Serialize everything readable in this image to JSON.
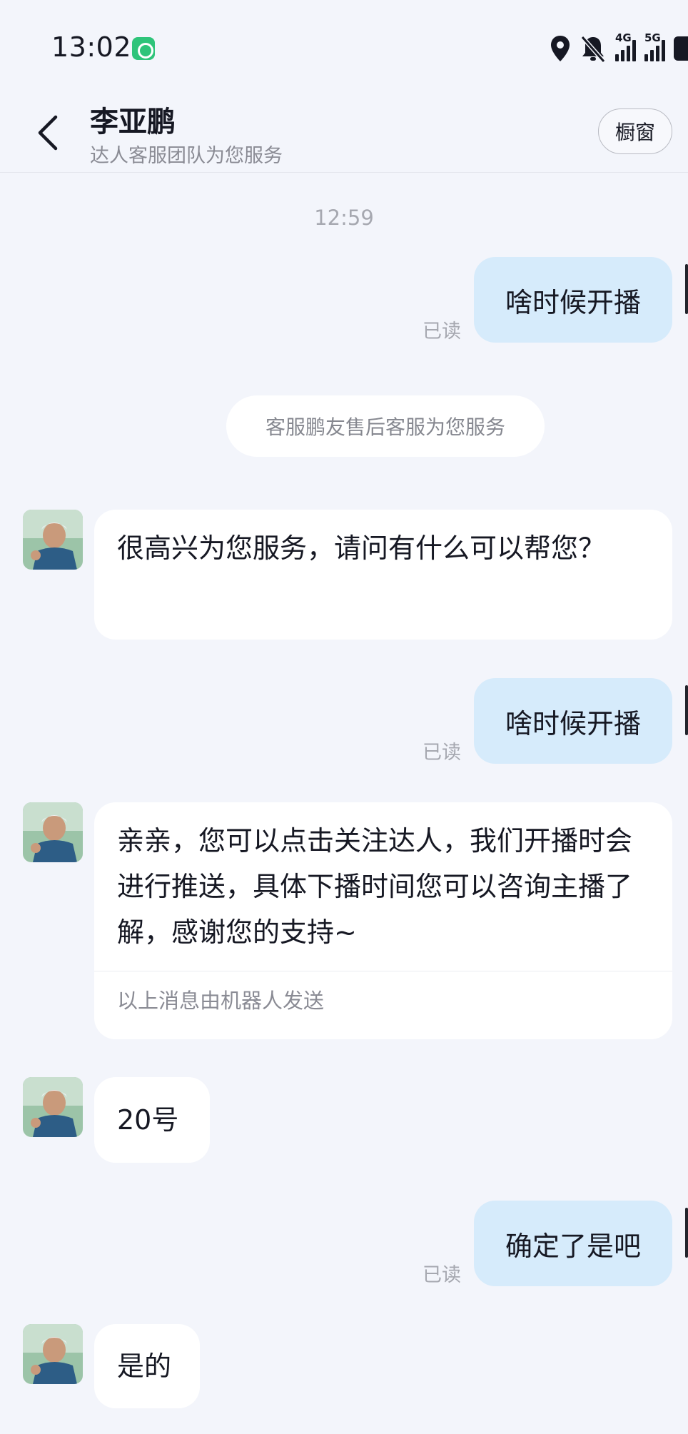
{
  "status_bar": {
    "time": "13:02",
    "signal_4g": "4G",
    "signal_5g": "5G"
  },
  "header": {
    "title": "李亚鹏",
    "subtitle": "达人客服团队为您服务",
    "shop_button": "橱窗"
  },
  "chat": {
    "timestamp": "12:59",
    "system_notice": "客服鹏友售后客服为您服务",
    "read_label": "已读",
    "messages": [
      {
        "from": "me",
        "text": "啥时候开播"
      },
      {
        "from": "agent",
        "text": "很高兴为您服务，请问有什么可以帮您？"
      },
      {
        "from": "me",
        "text": "啥时候开播"
      },
      {
        "from": "agent",
        "text": "亲亲，您可以点击关注达人，我们开播时会进行推送，具体下播时间您可以咨询主播了解，感谢您的支持~",
        "footer": "以上消息由机器人发送"
      },
      {
        "from": "agent",
        "text": "20号"
      },
      {
        "from": "me",
        "text": "确定了是吧"
      },
      {
        "from": "agent",
        "text": "是的"
      }
    ]
  }
}
